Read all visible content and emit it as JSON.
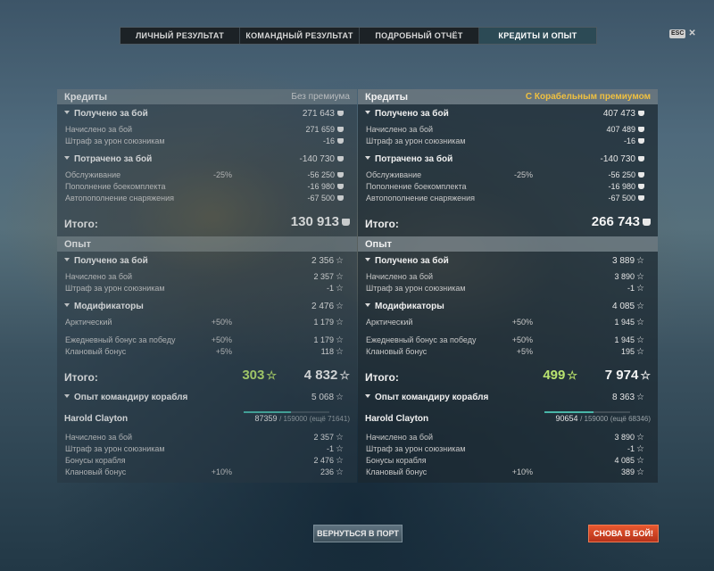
{
  "tabs": [
    {
      "label": "ЛИЧНЫЙ РЕЗУЛЬТАТ",
      "active": false
    },
    {
      "label": "КОМАНДНЫЙ РЕЗУЛЬТАТ",
      "active": false
    },
    {
      "label": "ПОДРОБНЫЙ ОТЧЁТ",
      "active": false
    },
    {
      "label": "КРЕДИТЫ И ОПЫТ",
      "active": true
    }
  ],
  "esc": {
    "key": "ESC",
    "close": "✕"
  },
  "left": {
    "credits_header": "Кредиты",
    "subtitle": "Без премиума",
    "earned_label": "Получено за бой",
    "earned_value": "271 643",
    "accrued_label": "Начислено за бой",
    "accrued_value": "271 659",
    "penalty_label": "Штраф за урон союзникам",
    "penalty_value": "-16",
    "spent_label": "Потрачено за бой",
    "spent_value": "-140 730",
    "service_label": "Обслуживание",
    "service_pct": "-25%",
    "service_value": "-56 250",
    "ammo_label": "Пополнение боекомплекта",
    "ammo_value": "-16 980",
    "equip_label": "Автопополнение снаряжения",
    "equip_value": "-67 500",
    "credits_total_label": "Итого:",
    "credits_total_value": "130 913",
    "xp_header": "Опыт",
    "xp_earned_label": "Получено за бой",
    "xp_earned_value": "2 356",
    "xp_accrued_label": "Начислено за бой",
    "xp_accrued_value": "2 357",
    "xp_penalty_label": "Штраф за урон союзникам",
    "xp_penalty_value": "-1",
    "mods_label": "Модификаторы",
    "mods_value": "2 476",
    "arctic_label": "Арктический",
    "arctic_pct": "+50%",
    "arctic_value": "1 179",
    "daily_label": "Ежедневный бонус за победу",
    "daily_pct": "+50%",
    "daily_value": "1 179",
    "clan_label": "Клановый бонус",
    "clan_pct": "+5%",
    "clan_value": "118",
    "xp_total_label": "Итого:",
    "xp_total_free": "303",
    "xp_total_value": "4 832",
    "cmdxp_label": "Опыт командиру корабля",
    "cmdxp_value": "5 068",
    "commander_name": "Harold Clayton",
    "commander_xp": "87359",
    "commander_max": "/ 159000",
    "commander_left": "(ещё 71641)",
    "commander_progress": 0.549,
    "c_accrued_label": "Начислено за бой",
    "c_accrued_value": "2 357",
    "c_penalty_label": "Штраф за урон союзникам",
    "c_penalty_value": "-1",
    "c_ship_label": "Бонусы корабля",
    "c_ship_value": "2 476",
    "c_clan_label": "Клановый бонус",
    "c_clan_pct": "+10%",
    "c_clan_value": "236"
  },
  "right": {
    "credits_header": "Кредиты",
    "subtitle": "С Корабельным премиумом",
    "earned_label": "Получено за бой",
    "earned_value": "407 473",
    "accrued_label": "Начислено за бой",
    "accrued_value": "407 489",
    "penalty_label": "Штраф за урон союзникам",
    "penalty_value": "-16",
    "spent_label": "Потрачено за бой",
    "spent_value": "-140 730",
    "service_label": "Обслуживание",
    "service_pct": "-25%",
    "service_value": "-56 250",
    "ammo_label": "Пополнение боекомплекта",
    "ammo_value": "-16 980",
    "equip_label": "Автопополнение снаряжения",
    "equip_value": "-67 500",
    "credits_total_label": "Итого:",
    "credits_total_value": "266 743",
    "xp_header": "Опыт",
    "xp_earned_label": "Получено за бой",
    "xp_earned_value": "3 889",
    "xp_accrued_label": "Начислено за бой",
    "xp_accrued_value": "3 890",
    "xp_penalty_label": "Штраф за урон союзникам",
    "xp_penalty_value": "-1",
    "mods_label": "Модификаторы",
    "mods_value": "4 085",
    "arctic_label": "Арктический",
    "arctic_pct": "+50%",
    "arctic_value": "1 945",
    "daily_label": "Ежедневный бонус за победу",
    "daily_pct": "+50%",
    "daily_value": "1 945",
    "clan_label": "Клановый бонус",
    "clan_pct": "+5%",
    "clan_value": "195",
    "xp_total_label": "Итого:",
    "xp_total_free": "499",
    "xp_total_value": "7 974",
    "cmdxp_label": "Опыт командиру корабля",
    "cmdxp_value": "8 363",
    "commander_name": "Harold Clayton",
    "commander_xp": "90654",
    "commander_max": "/ 159000",
    "commander_left": "(ещё 68346)",
    "commander_progress": 0.57,
    "c_accrued_label": "Начислено за бой",
    "c_accrued_value": "3 890",
    "c_penalty_label": "Штраф за урон союзникам",
    "c_penalty_value": "-1",
    "c_ship_label": "Бонусы корабля",
    "c_ship_value": "4 085",
    "c_clan_label": "Клановый бонус",
    "c_clan_pct": "+10%",
    "c_clan_value": "389"
  },
  "buttons": {
    "port": "ВЕРНУТЬСЯ В ПОРТ",
    "battle": "СНОВА В БОЙ!"
  }
}
